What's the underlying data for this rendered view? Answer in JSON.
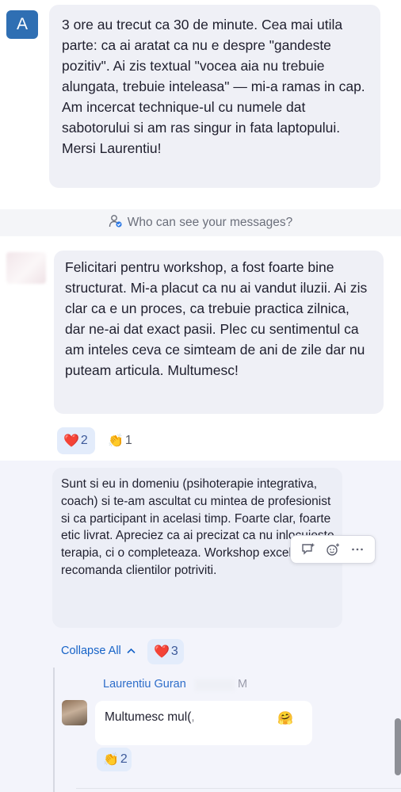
{
  "messages": [
    {
      "avatar_letter": "A",
      "text": "3 ore au trecut ca 30 de minute. Cea mai utila parte: ca ai aratat ca nu e despre \"gandeste pozitiv\". Ai zis textual \"vocea aia nu trebuie alungata, trebuie inteleasa\" — mi-a ramas in cap. Am incercat technique-ul cu numele dat sabotorului si am ras singur in fata laptopului. Mersi Laurentiu!"
    },
    {
      "text": "Felicitari pentru workshop, a fost foarte bine structurat. Mi-a placut ca nu ai vandut iluzii. Ai zis clar ca e un proces, ca trebuie practica zilnica, dar ne-ai dat exact pasii. Plec cu sentimentul ca am inteles ceva ce simteam de ani de zile dar nu puteam articula. Multumesc!",
      "reactions": [
        {
          "emoji": "❤️",
          "count": "2"
        },
        {
          "emoji": "👏",
          "count": "1"
        }
      ]
    },
    {
      "text": "Sunt si eu in domeniu (psihoterapie integrativa, coach) si te-am ascultat cu mintea de profesionist si ca participant in acelasi timp. Foarte clar, foarte etic livrat. Apreciez ca ai precizat ca nu inlocuieste terapia, ci o completeaza. Workshop excelent, voi recomanda clientilor potriviti.",
      "reactions": [
        {
          "emoji": "❤️",
          "count": "3"
        }
      ]
    }
  ],
  "notice": {
    "text": "Who can see your messages?"
  },
  "thread": {
    "collapse_label": "Collapse All"
  },
  "reply": {
    "author": "Laurentiu Guran",
    "time_fragment": "M",
    "text": "Multumesc mul(,",
    "emoji": "🤗",
    "reactions": [
      {
        "emoji": "👏",
        "count": "2"
      }
    ]
  },
  "colors": {
    "accent": "#1663c7",
    "avatar_bg": "#2f6fb3",
    "bubble": "#eff0f6",
    "thread_bg": "#f3f4fb"
  }
}
